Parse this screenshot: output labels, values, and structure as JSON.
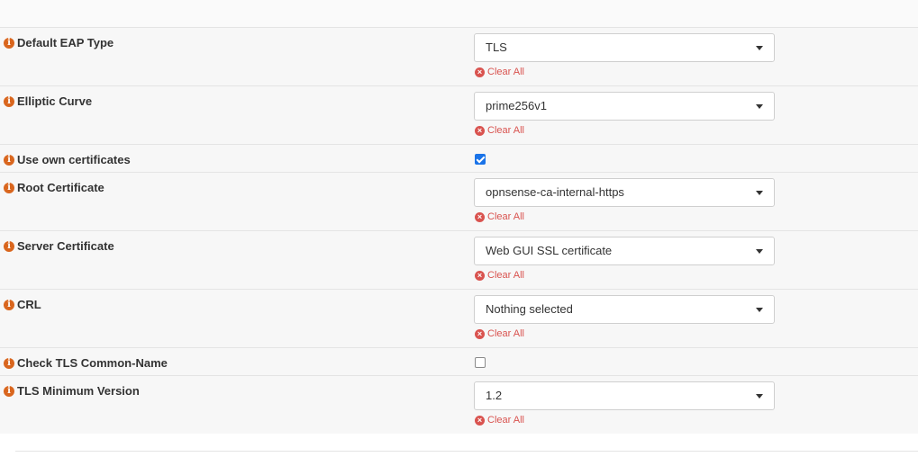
{
  "settings": {
    "default_eap_type": {
      "label": "Default EAP Type",
      "value": "TLS",
      "clear": "Clear All"
    },
    "elliptic_curve": {
      "label": "Elliptic Curve",
      "value": "prime256v1",
      "clear": "Clear All"
    },
    "use_own_certificates": {
      "label": "Use own certificates",
      "checked": true
    },
    "root_certificate": {
      "label": "Root Certificate",
      "value": "opnsense-ca-internal-https",
      "clear": "Clear All"
    },
    "server_certificate": {
      "label": "Server Certificate",
      "value": "Web GUI SSL certificate",
      "clear": "Clear All"
    },
    "crl": {
      "label": "CRL",
      "value": "Nothing selected",
      "clear": "Clear All"
    },
    "check_tls_common_name": {
      "label": "Check TLS Common-Name",
      "checked": false
    },
    "tls_minimum_version": {
      "label": "TLS Minimum Version",
      "value": "1.2",
      "clear": "Clear All"
    }
  },
  "icons": {
    "info": "info-circle-icon",
    "clear": "times-circle-icon",
    "caret": "caret-down-icon"
  },
  "colors": {
    "info_icon": "#d9661e",
    "clear_link": "#d9534f",
    "checkbox_checked": "#1a73e8"
  }
}
